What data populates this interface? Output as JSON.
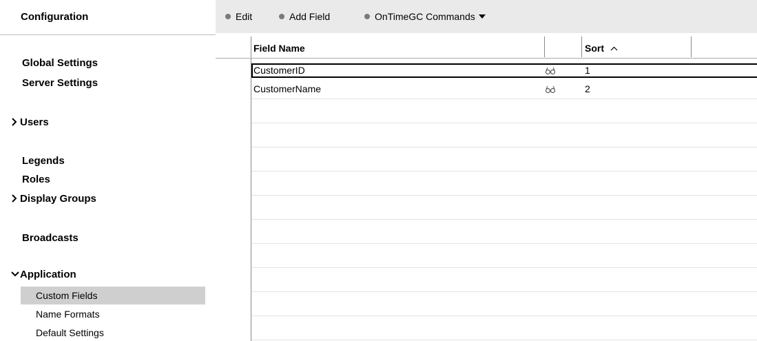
{
  "sidebar": {
    "title": "Configuration",
    "items": [
      {
        "label": "Global Settings"
      },
      {
        "label": "Server Settings"
      },
      {
        "label": "Users"
      },
      {
        "label": "Legends"
      },
      {
        "label": "Roles"
      },
      {
        "label": "Display Groups"
      },
      {
        "label": "Broadcasts"
      },
      {
        "label": "Application"
      }
    ],
    "application_children": [
      {
        "label": "Custom Fields",
        "selected": true
      },
      {
        "label": "Name Formats",
        "selected": false
      },
      {
        "label": "Default Settings",
        "selected": false
      }
    ],
    "expanded_chevron": "✓",
    "collapsed_chevron": ">"
  },
  "toolbar": {
    "edit_label": "Edit",
    "add_field_label": "Add Field",
    "commands_label": "OnTimeGC Commands"
  },
  "grid": {
    "columns": [
      "Field Name",
      "",
      "Sort"
    ],
    "sort_indicator": "^",
    "rows": [
      {
        "field_name": "CustomerID",
        "icon": "view-glasses-icon",
        "sort": "1",
        "selected": true
      },
      {
        "field_name": "CustomerName",
        "icon": "view-glasses-icon",
        "sort": "2",
        "selected": false
      }
    ]
  },
  "colors": {
    "toolbar_bg": "#eaeaea",
    "selected_item_bg": "#cfcfcf",
    "toolbar_dot": "#7a7a7a"
  }
}
